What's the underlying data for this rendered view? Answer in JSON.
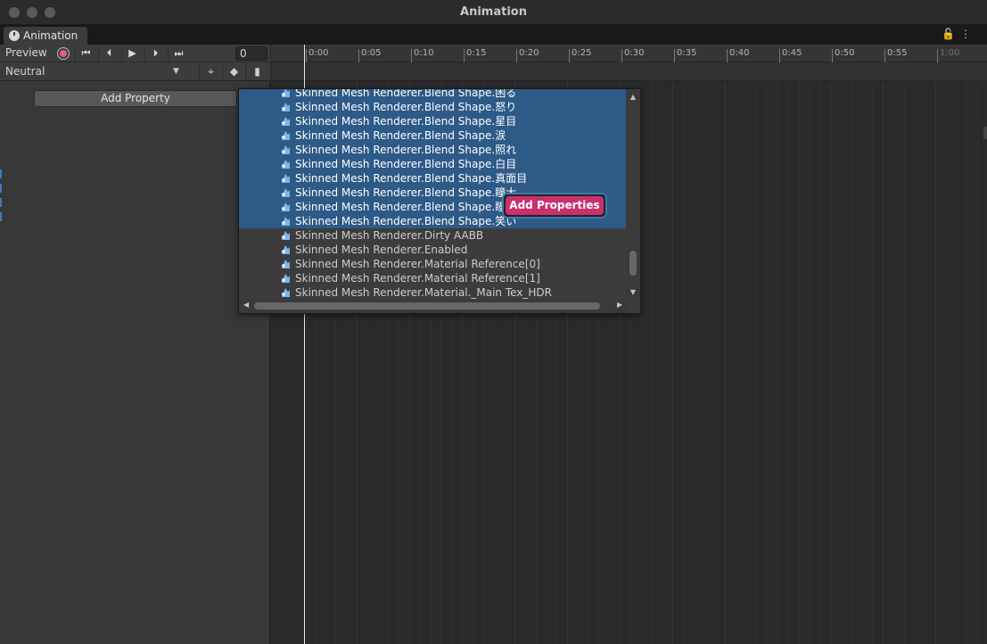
{
  "window": {
    "title": "Animation"
  },
  "tab": {
    "label": "Animation"
  },
  "controls": {
    "preview_label": "Preview",
    "frame_value": "0",
    "clip_name": "Neutral",
    "add_property_label": "Add Property"
  },
  "timeline": {
    "ticks": [
      "0:00",
      "0:05",
      "0:10",
      "0:15",
      "0:20",
      "0:25",
      "0:30",
      "0:35",
      "0:40",
      "0:45",
      "0:50",
      "0:55",
      "1:00"
    ]
  },
  "popup": {
    "items": [
      {
        "label": "Skinned Mesh Renderer.Blend Shape.困る",
        "selected": true
      },
      {
        "label": "Skinned Mesh Renderer.Blend Shape.怒り",
        "selected": true
      },
      {
        "label": "Skinned Mesh Renderer.Blend Shape.星目",
        "selected": true
      },
      {
        "label": "Skinned Mesh Renderer.Blend Shape.涙",
        "selected": true
      },
      {
        "label": "Skinned Mesh Renderer.Blend Shape.照れ",
        "selected": true
      },
      {
        "label": "Skinned Mesh Renderer.Blend Shape.白目",
        "selected": true
      },
      {
        "label": "Skinned Mesh Renderer.Blend Shape.真面目",
        "selected": true
      },
      {
        "label": "Skinned Mesh Renderer.Blend Shape.瞳大",
        "selected": true
      },
      {
        "label": "Skinned Mesh Renderer.Blend Shape.瞳小",
        "selected": true
      },
      {
        "label": "Skinned Mesh Renderer.Blend Shape.笑い",
        "selected": true
      },
      {
        "label": "Skinned Mesh Renderer.Dirty AABB",
        "selected": false
      },
      {
        "label": "Skinned Mesh Renderer.Enabled",
        "selected": false
      },
      {
        "label": "Skinned Mesh Renderer.Material Reference[0]",
        "selected": false
      },
      {
        "label": "Skinned Mesh Renderer.Material Reference[1]",
        "selected": false
      },
      {
        "label": "Skinned Mesh Renderer.Material._Main Tex_HDR",
        "selected": false
      }
    ],
    "add_properties_label": "Add Properties"
  },
  "colors": {
    "selection": "#2d5a87",
    "accent_button": "#c8316d",
    "record": "#e0607a"
  }
}
